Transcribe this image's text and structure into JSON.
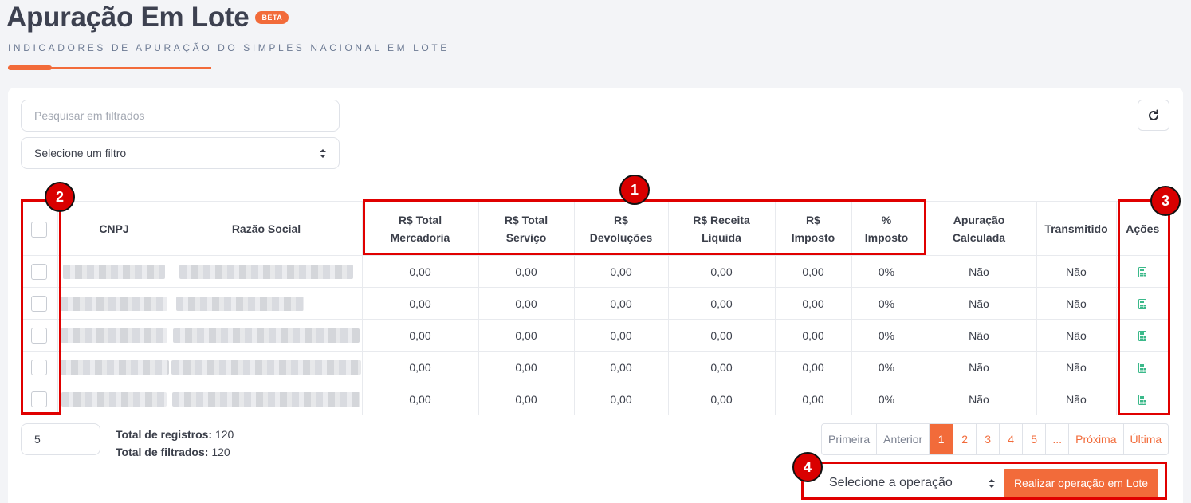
{
  "header": {
    "title": "Apuração Em Lote",
    "badge": "BETA",
    "subtitle": "INDICADORES DE APURAÇÃO DO SIMPLES NACIONAL EM LOTE"
  },
  "toolbar": {
    "search_placeholder": "Pesquisar em filtrados",
    "filter_value": "Selecione um filtro",
    "refresh_icon": "refresh-icon"
  },
  "table": {
    "columns": [
      {
        "line1": "",
        "line2": ""
      },
      {
        "line1": "CNPJ",
        "line2": ""
      },
      {
        "line1": "Razão Social",
        "line2": ""
      },
      {
        "line1": "R$ Total",
        "line2": "Mercadoria"
      },
      {
        "line1": "R$ Total",
        "line2": "Serviço"
      },
      {
        "line1": "R$",
        "line2": "Devoluções"
      },
      {
        "line1": "R$ Receita",
        "line2": "Líquida"
      },
      {
        "line1": "R$",
        "line2": "Imposto"
      },
      {
        "line1": "%",
        "line2": "Imposto"
      },
      {
        "line1": "Apuração",
        "line2": "Calculada"
      },
      {
        "line1": "Transmitido",
        "line2": ""
      },
      {
        "line1": "Ações",
        "line2": ""
      }
    ],
    "rows": [
      {
        "total_mercadoria": "0,00",
        "total_servico": "0,00",
        "devolucoes": "0,00",
        "receita_liquida": "0,00",
        "imposto": "0,00",
        "pct_imposto": "0%",
        "apuracao_calculada": "Não",
        "transmitido": "Não"
      },
      {
        "total_mercadoria": "0,00",
        "total_servico": "0,00",
        "devolucoes": "0,00",
        "receita_liquida": "0,00",
        "imposto": "0,00",
        "pct_imposto": "0%",
        "apuracao_calculada": "Não",
        "transmitido": "Não"
      },
      {
        "total_mercadoria": "0,00",
        "total_servico": "0,00",
        "devolucoes": "0,00",
        "receita_liquida": "0,00",
        "imposto": "0,00",
        "pct_imposto": "0%",
        "apuracao_calculada": "Não",
        "transmitido": "Não"
      },
      {
        "total_mercadoria": "0,00",
        "total_servico": "0,00",
        "devolucoes": "0,00",
        "receita_liquida": "0,00",
        "imposto": "0,00",
        "pct_imposto": "0%",
        "apuracao_calculada": "Não",
        "transmitido": "Não"
      },
      {
        "total_mercadoria": "0,00",
        "total_servico": "0,00",
        "devolucoes": "0,00",
        "receita_liquida": "0,00",
        "imposto": "0,00",
        "pct_imposto": "0%",
        "apuracao_calculada": "Não",
        "transmitido": "Não"
      }
    ],
    "action_icon": "calculator-icon"
  },
  "footer": {
    "per_page": "5",
    "total_registros_label": "Total de registros:",
    "total_registros": "120",
    "total_filtrados_label": "Total de filtrados:",
    "total_filtrados": "120"
  },
  "pagination": {
    "items": [
      {
        "label": "Primeira",
        "state": "disabled"
      },
      {
        "label": "Anterior",
        "state": "disabled"
      },
      {
        "label": "1",
        "state": "active"
      },
      {
        "label": "2",
        "state": "normal"
      },
      {
        "label": "3",
        "state": "normal"
      },
      {
        "label": "4",
        "state": "normal"
      },
      {
        "label": "5",
        "state": "normal"
      },
      {
        "label": "...",
        "state": "normal"
      },
      {
        "label": "Próxima",
        "state": "normal"
      },
      {
        "label": "Última",
        "state": "normal"
      }
    ]
  },
  "batch": {
    "operation_value": "Selecione a operação",
    "button_label": "Realizar operação em Lote"
  },
  "annotations": [
    "1",
    "2",
    "3",
    "4"
  ],
  "colors": {
    "accent": "#f26b3a",
    "highlight": "#e00000",
    "icon_green": "#3bb98a"
  }
}
